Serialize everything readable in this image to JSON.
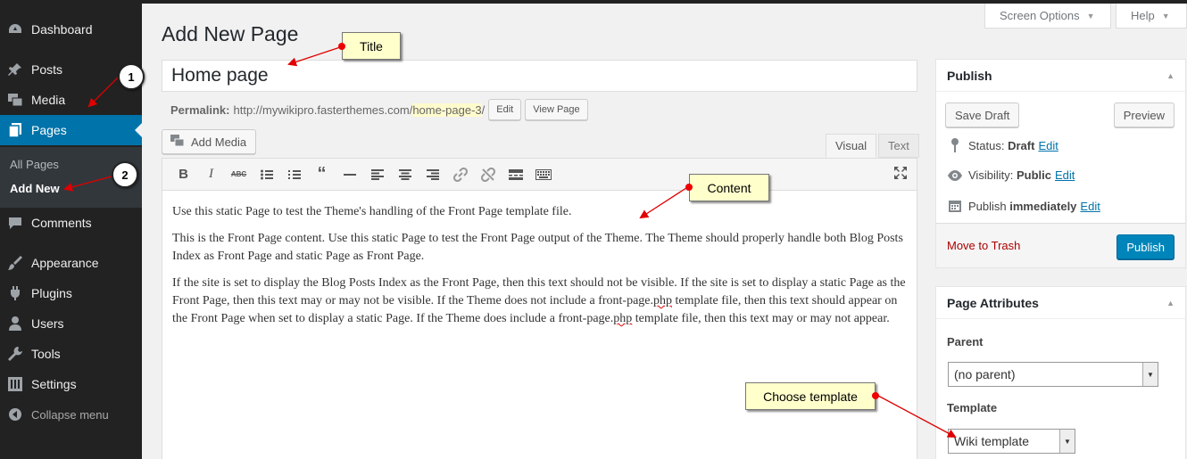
{
  "sidebar": {
    "items": [
      {
        "label": "Dashboard",
        "icon": "dashboard-icon"
      },
      {
        "label": "Posts",
        "icon": "pin-icon"
      },
      {
        "label": "Media",
        "icon": "media-icon"
      },
      {
        "label": "Pages",
        "icon": "pages-icon"
      },
      {
        "label": "Comments",
        "icon": "comment-icon"
      },
      {
        "label": "Appearance",
        "icon": "brush-icon"
      },
      {
        "label": "Plugins",
        "icon": "plugin-icon"
      },
      {
        "label": "Users",
        "icon": "user-icon"
      },
      {
        "label": "Tools",
        "icon": "wrench-icon"
      },
      {
        "label": "Settings",
        "icon": "settings-icon"
      }
    ],
    "submenu": {
      "all_pages": "All Pages",
      "add_new": "Add New"
    },
    "collapse": "Collapse menu"
  },
  "screen_options": "Screen Options",
  "help": "Help",
  "heading": "Add New Page",
  "title_value": "Home page",
  "permalink": {
    "label": "Permalink:",
    "base": "http://mywikipro.fasterthemes.com/",
    "slug": "home-page-3",
    "trail": "/",
    "edit": "Edit",
    "view": "View Page"
  },
  "add_media": "Add Media",
  "editor_tabs": {
    "visual": "Visual",
    "text": "Text"
  },
  "content": {
    "p1": "Use this static Page to test the Theme's handling of the Front Page template file.",
    "p2": "This is the Front Page content. Use this static Page to test the Front Page output of the Theme. The Theme should properly handle both Blog Posts Index as Front Page and static Page as Front Page.",
    "p3a": "If the site is set to display the Blog Posts Index as the Front Page, then this text should not be visible. If the site is set to display a static Page as the Front Page, then this text may or may not be visible. If the Theme does not include a front-page.",
    "p3b": "php",
    "p3c": " template file, then this text should appear on the Front Page when set to display a static Page. If the Theme does include a front-page.",
    "p3d": "php",
    "p3e": " template file, then this text may or may not appear."
  },
  "publish": {
    "title": "Publish",
    "save_draft": "Save Draft",
    "preview": "Preview",
    "status_label": "Status:",
    "status_value": "Draft",
    "visibility_label": "Visibility:",
    "visibility_value": "Public",
    "publish_label": "Publish",
    "publish_value": "immediately",
    "edit": "Edit",
    "trash": "Move to Trash",
    "publish_button": "Publish"
  },
  "page_attributes": {
    "title": "Page Attributes",
    "parent_label": "Parent",
    "parent_value": "(no parent)",
    "template_label": "Template",
    "template_value": "Wiki template"
  },
  "annotations": {
    "title": "Title",
    "content": "Content",
    "choose_template": "Choose template",
    "badge1": "1",
    "badge2": "2"
  },
  "colors": {
    "accent": "#0073aa",
    "sidebar": "#222222",
    "callout": "#ffffcc",
    "arrow": "#e00000"
  }
}
